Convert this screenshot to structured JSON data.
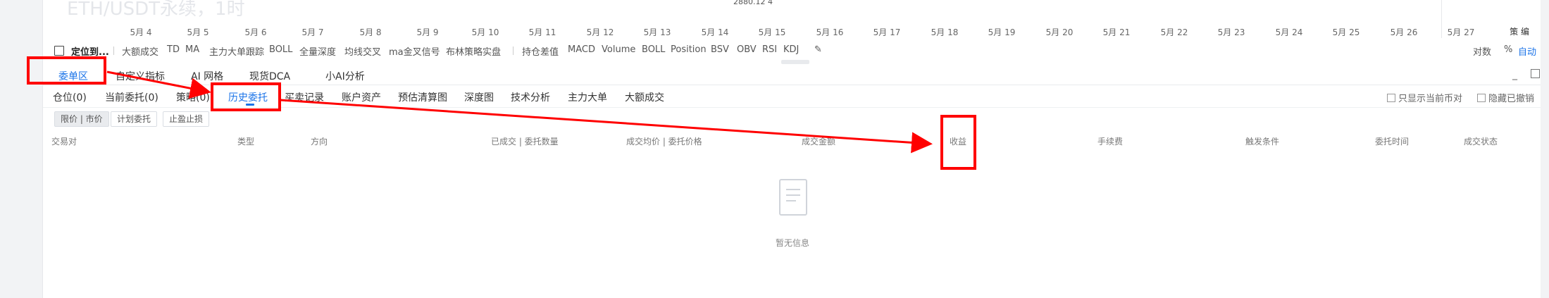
{
  "chart": {
    "title": "ETH/USDT永续，1时",
    "price_label": "2880.12 4",
    "dates": [
      "5月 4",
      "5月 5",
      "5月 6",
      "5月 7",
      "5月 8",
      "5月 9",
      "5月 10",
      "5月 11",
      "5月 12",
      "5月 13",
      "5月 14",
      "5月 15",
      "5月 16",
      "5月 17",
      "5月 18",
      "5月 19",
      "5月 20",
      "5月 21",
      "5月 22",
      "5月 23",
      "5月 24",
      "5月 25",
      "5月 26",
      "5月 27"
    ],
    "right_label": "策 编"
  },
  "toolbar": {
    "locate": "定位到...",
    "items": [
      "大额成交",
      "TD",
      "MA",
      "主力大单跟踪",
      "BOLL",
      "全量深度",
      "均线交叉",
      "ma金叉信号",
      "布林策略实盘",
      "持仓差值",
      "MACD",
      "Volume",
      "BOLL",
      "Position",
      "BSV",
      "OBV",
      "RSI",
      "KDJ"
    ],
    "right": {
      "log": "对数",
      "percent": "%",
      "auto": "自动"
    }
  },
  "panel_tabs": [
    "委单区",
    "自定义指标",
    "AI 网格",
    "现货DCA",
    "小AI分析"
  ],
  "panel_controls": {
    "minimize": "_"
  },
  "order_tabs": [
    "仓位(0)",
    "当前委托(0)",
    "策略(0)",
    "历史委托",
    "买卖记录",
    "账户资产",
    "预估清算图",
    "深度图",
    "技术分析",
    "主力大单",
    "大额成交"
  ],
  "filters": {
    "current_only": "只显示当前币对",
    "hide_cancelled": "隐藏已撤销"
  },
  "order_types": [
    "限价 | 市价",
    "计划委托",
    "止盈止损"
  ],
  "columns": [
    "交易对",
    "类型",
    "方向",
    "已成交 | 委托数量",
    "成交均价 | 委托价格",
    "成交金额",
    "收益",
    "手续费",
    "触发条件",
    "委托时间",
    "成交状态"
  ],
  "empty_state": {
    "icon": "empty-document-icon",
    "text": "暂无信息"
  },
  "annotation_color": "#ff0000"
}
